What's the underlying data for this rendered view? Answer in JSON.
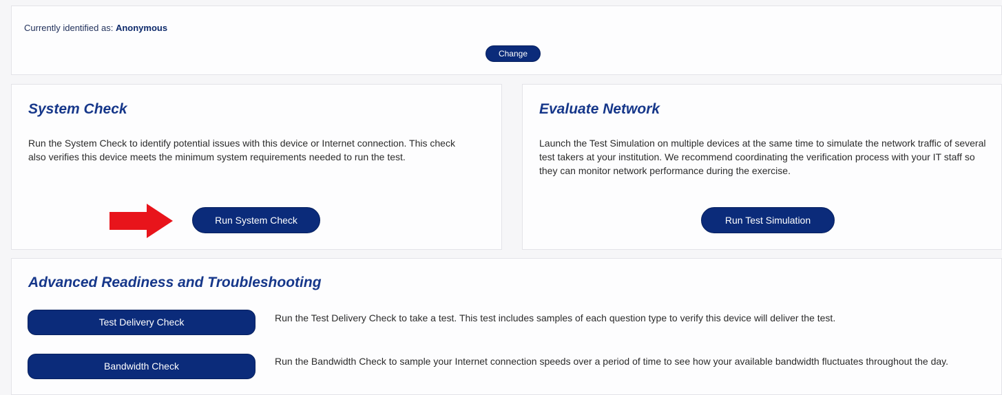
{
  "identity": {
    "label": "Currently identified as:",
    "value": "Anonymous",
    "change_label": "Change"
  },
  "system_check": {
    "title": "System Check",
    "description": "Run the System Check to identify potential issues with this device or Internet connection. This check also verifies this device meets the minimum system requirements needed to run the test.",
    "button_label": "Run System Check",
    "pointer_icon": "red-arrow-icon",
    "pointer_color": "#e8141b"
  },
  "evaluate_network": {
    "title": "Evaluate Network",
    "description": "Launch the Test Simulation on multiple devices at the same time to simulate the network traffic of several test takers at your institution. We recommend coordinating the verification process with your IT staff so they can monitor network performance during the exercise.",
    "button_label": "Run Test Simulation"
  },
  "advanced": {
    "title": "Advanced Readiness and Troubleshooting",
    "items": [
      {
        "button_label": "Test Delivery Check",
        "description": "Run the Test Delivery Check to take a test. This test includes samples of each question type to verify this device will deliver the test."
      },
      {
        "button_label": "Bandwidth Check",
        "description": "Run the Bandwidth Check to sample your Internet connection speeds over a period of time to see how your available bandwidth fluctuates throughout the day."
      }
    ]
  },
  "colors": {
    "button_bg": "#0b2b7a",
    "title": "#16378a",
    "page_bg": "#f6f6f8"
  }
}
